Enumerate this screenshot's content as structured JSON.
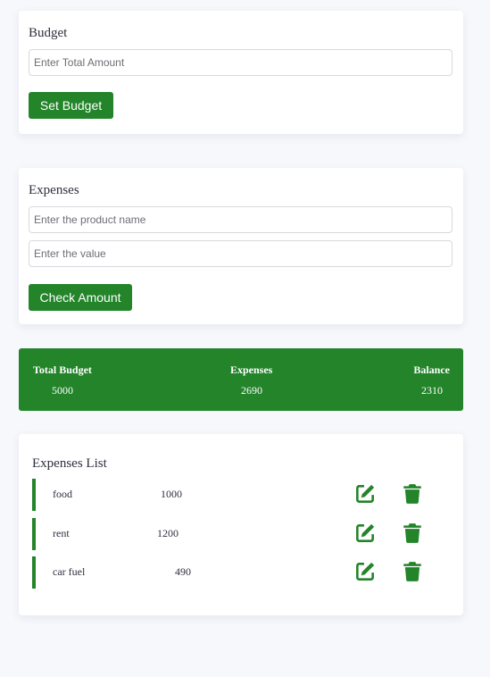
{
  "budget": {
    "title": "Budget",
    "amount_placeholder": "Enter Total Amount",
    "amount_value": "",
    "set_button": "Set Budget"
  },
  "expenses_form": {
    "title": "Expenses",
    "product_placeholder": "Enter the product name",
    "product_value": "",
    "value_placeholder": "Enter the value",
    "value_value": "",
    "check_button": "Check Amount"
  },
  "summary": {
    "total_budget_label": "Total Budget",
    "total_budget_value": "5000",
    "expenses_label": "Expenses",
    "expenses_value": "2690",
    "balance_label": "Balance",
    "balance_value": "2310"
  },
  "expenses_list": {
    "title": "Expenses List",
    "items": [
      {
        "name": "food",
        "value": "1000"
      },
      {
        "name": "rent",
        "value": "1200"
      },
      {
        "name": "car fuel",
        "value": "490"
      }
    ],
    "edit_icon": "edit-icon",
    "delete_icon": "trash-icon"
  },
  "colors": {
    "accent": "#23842a",
    "background": "#f7f8fc",
    "card": "#ffffff"
  }
}
